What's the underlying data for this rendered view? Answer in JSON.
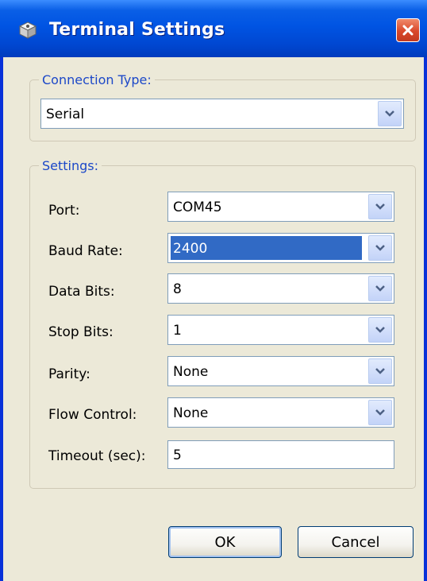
{
  "window": {
    "title": "Terminal Settings"
  },
  "connection": {
    "legend": "Connection Type:",
    "value": "Serial"
  },
  "settings": {
    "legend": "Settings:",
    "rows": [
      {
        "label": "Port:",
        "value": "COM45"
      },
      {
        "label": "Baud Rate:",
        "value": "2400"
      },
      {
        "label": "Data Bits:",
        "value": "8"
      },
      {
        "label": "Stop Bits:",
        "value": "1"
      },
      {
        "label": "Parity:",
        "value": "None"
      },
      {
        "label": "Flow Control:",
        "value": "None"
      },
      {
        "label": "Timeout (sec):",
        "value": "5"
      }
    ]
  },
  "buttons": {
    "ok": "OK",
    "cancel": "Cancel"
  },
  "colors": {
    "accent": "#316ac5",
    "legend": "#1c48c8",
    "titlebar": "#0054e3"
  },
  "icons": {
    "title": "gear-cube-icon",
    "close": "close-icon",
    "dropdown": "chevron-down-icon"
  }
}
